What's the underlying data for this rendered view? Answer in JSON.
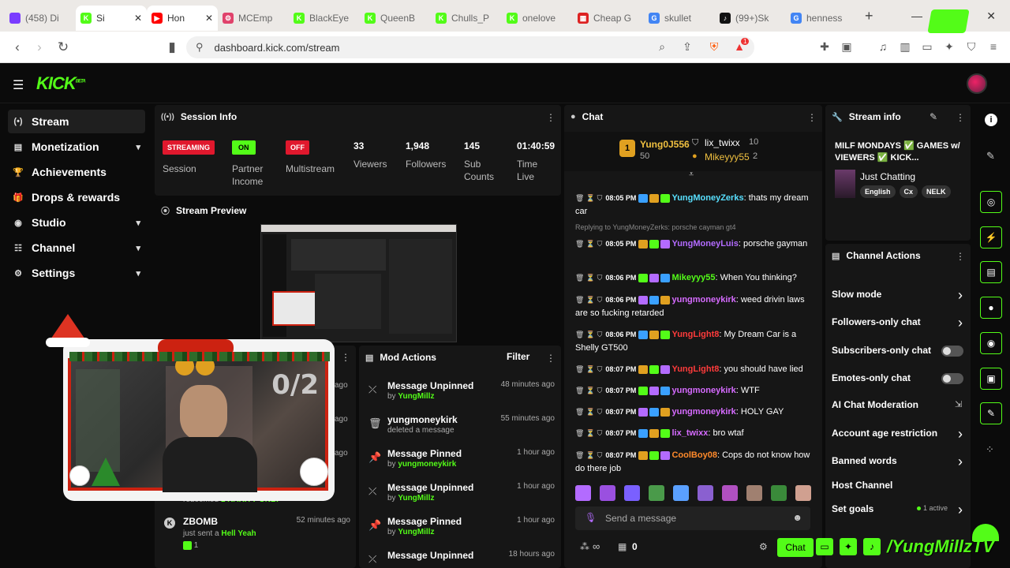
{
  "browser": {
    "tabs": [
      {
        "label": "(458) Di",
        "fav": "458",
        "color": "#7a3cff"
      },
      {
        "label": "Si",
        "fav": "K",
        "color": "#53fc18",
        "active": true
      },
      {
        "label": "Hon",
        "fav": "▶",
        "color": "#ff0000",
        "active2": true
      },
      {
        "label": "MCEmp",
        "fav": "⚙",
        "color": "#e0426b"
      },
      {
        "label": "BlackEye",
        "fav": "K",
        "color": "#53fc18"
      },
      {
        "label": "QueenB",
        "fav": "K",
        "color": "#53fc18"
      },
      {
        "label": "Chulls_P",
        "fav": "K",
        "color": "#53fc18"
      },
      {
        "label": "onelove",
        "fav": "K",
        "color": "#53fc18"
      },
      {
        "label": "Cheap G",
        "fav": "▦",
        "color": "#d22"
      },
      {
        "label": "skullet",
        "fav": "G",
        "color": "#4285f4"
      },
      {
        "label": "(99+)Sk",
        "fav": "♪",
        "color": "#111"
      },
      {
        "label": "henness",
        "fav": "G",
        "color": "#4285f4"
      }
    ],
    "new_tab": "+",
    "window": {
      "minimize": "—",
      "maximize": "▢",
      "close": "✕"
    },
    "url": "dashboard.kick.com/stream",
    "extensions_badge": "1"
  },
  "kick": {
    "logo": "KICK",
    "logo_sup": "BETA"
  },
  "sidebar": [
    {
      "label": "Stream",
      "icon": "(•)",
      "active": true
    },
    {
      "label": "Monetization",
      "icon": "▤",
      "chev": true
    },
    {
      "label": "Achievements",
      "icon": "🏆"
    },
    {
      "label": "Drops & rewards",
      "icon": "🎁"
    },
    {
      "label": "Studio",
      "icon": "◉",
      "chev": true
    },
    {
      "label": "Channel",
      "icon": "☷",
      "chev": true
    },
    {
      "label": "Settings",
      "icon": "⚙",
      "chev": true
    }
  ],
  "session": {
    "title": "Session Info",
    "streaming": "STREAMING",
    "streaming_label": "Session",
    "partner": "ON",
    "partner_label": "Partner Income",
    "multistream": "OFF",
    "multistream_label": "Multistream",
    "viewers": "33",
    "viewers_label": "Viewers",
    "followers": "1,948",
    "followers_label": "Followers",
    "subs": "145",
    "subs_label": "Sub Counts",
    "time": "01:40:59",
    "time_label": "Time Live"
  },
  "preview": {
    "title": "Stream Preview"
  },
  "overlay": {
    "counter": "0/2"
  },
  "activity": [
    {
      "text": "redeemed",
      "highlight": "1 RARITY ONLY"
    },
    {
      "user": "ZBOMB",
      "time": "52 minutes ago",
      "text": "just sent a",
      "highlight": "Hell Yeah",
      "count": "1"
    }
  ],
  "activity_times": [
    "ago",
    "ago",
    "ago"
  ],
  "mod_actions": {
    "title": "Mod Actions",
    "filter": "Filter",
    "items": [
      {
        "title": "Message Unpinned",
        "sub": "by",
        "user": "YungMillz",
        "time": "48 minutes ago",
        "icon": "⤫"
      },
      {
        "title": "yungmoneykirk",
        "sub": "deleted a message",
        "user": "",
        "time": "55 minutes ago",
        "icon": "🗑"
      },
      {
        "title": "Message Pinned",
        "sub": "by",
        "user": "yungmoneykirk",
        "time": "1 hour ago",
        "icon": "📌"
      },
      {
        "title": "Message Unpinned",
        "sub": "by",
        "user": "YungMillz",
        "time": "1 hour ago",
        "icon": "⤫"
      },
      {
        "title": "Message Pinned",
        "sub": "by",
        "user": "YungMillz",
        "time": "1 hour ago",
        "icon": "📌"
      },
      {
        "title": "Message Unpinned",
        "sub": "",
        "user": "",
        "time": "18 hours ago",
        "icon": "⤫"
      }
    ]
  },
  "chat": {
    "title": "Chat",
    "leaders": [
      {
        "rank": "1",
        "name": "Yung0J556",
        "count": "50"
      },
      {
        "name": "lix_twixx",
        "count": "10"
      },
      {
        "name": "Mikeyyy55",
        "count": "2"
      }
    ],
    "reply_note": "Replying to YungMoneyZerks: porsche cayman gt4",
    "messages": [
      {
        "time": "08:05 PM",
        "user": "YungMoneyZerks",
        "color": "#58e0ff",
        "text": "thats my dream car"
      },
      {
        "time": "08:05 PM",
        "user": "YungMoneyLuis",
        "color": "#b36bff",
        "text": "porsche gayman"
      },
      {
        "time": "08:06 PM",
        "user": "Mikeyyy55",
        "color": "#53fc18",
        "text": "When You thinking?"
      },
      {
        "time": "08:06 PM",
        "user": "yungmoneykirk",
        "color": "#d66bff",
        "text": "weed drivin laws are so fucking retarded"
      },
      {
        "time": "08:06 PM",
        "user": "YungLight8",
        "color": "#ff3b3b",
        "text": "My Dream Car is a Shelly GT500"
      },
      {
        "time": "08:07 PM",
        "user": "YungLight8",
        "color": "#ff3b3b",
        "text": "you should have lied"
      },
      {
        "time": "08:07 PM",
        "user": "yungmoneykirk",
        "color": "#d66bff",
        "text": "WTF"
      },
      {
        "time": "08:07 PM",
        "user": "yungmoneykirk",
        "color": "#d66bff",
        "text": "HOLY GAY"
      },
      {
        "time": "08:07 PM",
        "user": "lix_twixx",
        "color": "#d66bff",
        "text": "bro wtaf"
      },
      {
        "time": "08:07 PM",
        "user": "CoolBoy08",
        "color": "#ff8a2b",
        "text": "Cops do not know how do there job"
      }
    ],
    "placeholder": "Send a message",
    "infinity": "∞",
    "points": "0",
    "send": "Chat"
  },
  "stream_info": {
    "title": "Stream info",
    "stream_title": "MILF MONDAYS ✅ GAMES w/ VIEWERS ✅ KICK...",
    "category": "Just Chatting",
    "tags": [
      "English",
      "Cx",
      "NELK"
    ]
  },
  "channel_actions": {
    "title": "Channel Actions",
    "items": [
      {
        "label": "Slow mode",
        "type": "chev"
      },
      {
        "label": "Followers-only chat",
        "type": "chev"
      },
      {
        "label": "Subscribers-only chat",
        "type": "toggle"
      },
      {
        "label": "Emotes-only chat",
        "type": "toggle"
      },
      {
        "label": "AI Chat Moderation",
        "type": "ext"
      },
      {
        "label": "Account age restriction",
        "type": "chev"
      },
      {
        "label": "Banned words",
        "type": "chev"
      },
      {
        "label": "Host Channel",
        "type": "none"
      },
      {
        "label": "Set goals",
        "type": "chev",
        "note": "1 active"
      }
    ]
  },
  "watermark": "/YungMillzTV",
  "accent": "#53fc18"
}
